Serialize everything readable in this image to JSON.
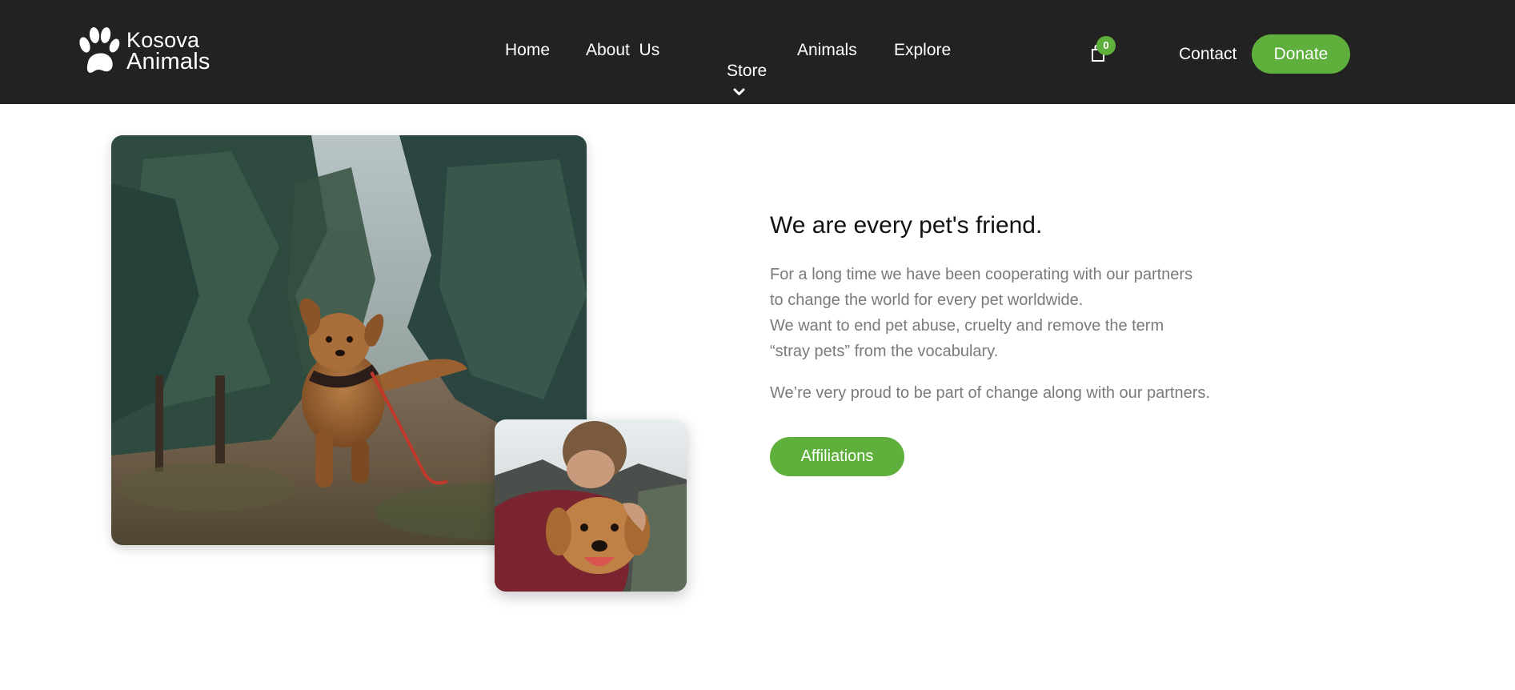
{
  "header": {
    "logo": {
      "line1": "Kosova",
      "line2": "Animals",
      "icon": "paw-icon"
    },
    "nav": [
      {
        "label": "Home"
      },
      {
        "label": "About  Us"
      },
      {
        "label": "Store",
        "icon": "chevron-down-icon"
      },
      {
        "label": "Animals"
      },
      {
        "label": "Explore"
      }
    ],
    "cart": {
      "icon": "shopping-bag-icon",
      "count": "0"
    },
    "contact_label": "Contact",
    "donate_label": "Donate"
  },
  "main": {
    "images": [
      {
        "subject": "puppy-running-in-forest"
      },
      {
        "subject": "man-hugging-golden-retriever"
      }
    ],
    "heading": "We are every pet's friend.",
    "paragraph1": [
      "For a long time we have been cooperating with our partners",
      "to change the world for every pet worldwide.",
      "We want to end pet abuse, cruelty and remove the term",
      "“stray pets” from the vocabulary."
    ],
    "paragraph2": "We’re very proud to be part of change along with our partners.",
    "affiliations_label": "Affiliations"
  },
  "colors": {
    "header_bg": "#222222",
    "accent": "#5eaf3c",
    "body_text": "#7a7a7a",
    "heading_text": "#111111"
  }
}
